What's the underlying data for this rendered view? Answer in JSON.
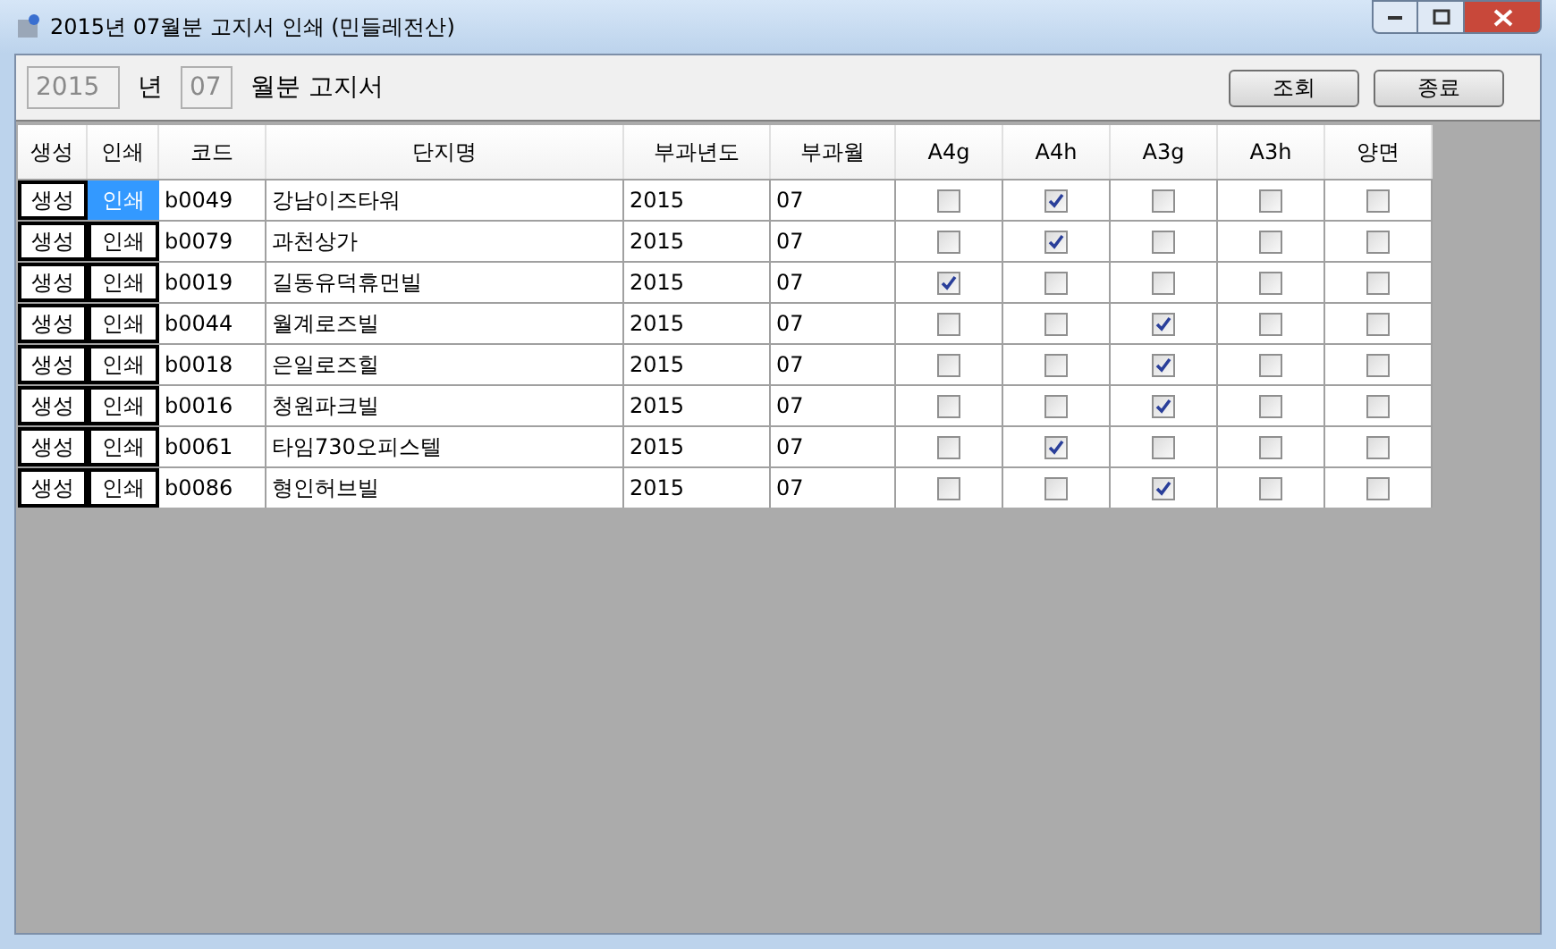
{
  "window": {
    "title": "2015년 07월분 고지서 인쇄 (민들레전산)"
  },
  "toolbar": {
    "year": "2015",
    "year_label": "년",
    "month": "07",
    "month_label": "월분 고지서",
    "buttons": [
      "조회",
      "종료"
    ]
  },
  "table": {
    "columns": [
      "생성",
      "인쇄",
      "코드",
      "단지명",
      "부과년도",
      "부과월",
      "A4g",
      "A4h",
      "A3g",
      "A3h",
      "양면"
    ],
    "rows": [
      {
        "create": "생성",
        "print": "인쇄",
        "selected": true,
        "code": "b0049",
        "name": "강남이즈타워",
        "year": "2015",
        "month": "07",
        "checks": [
          false,
          true,
          false,
          false,
          false
        ]
      },
      {
        "create": "생성",
        "print": "인쇄",
        "selected": false,
        "code": "b0079",
        "name": "과천상가",
        "year": "2015",
        "month": "07",
        "checks": [
          false,
          true,
          false,
          false,
          false
        ]
      },
      {
        "create": "생성",
        "print": "인쇄",
        "selected": false,
        "code": "b0019",
        "name": "길동유덕휴먼빌",
        "year": "2015",
        "month": "07",
        "checks": [
          true,
          false,
          false,
          false,
          false
        ]
      },
      {
        "create": "생성",
        "print": "인쇄",
        "selected": false,
        "code": "b0044",
        "name": "월계로즈빌",
        "year": "2015",
        "month": "07",
        "checks": [
          false,
          false,
          true,
          false,
          false
        ]
      },
      {
        "create": "생성",
        "print": "인쇄",
        "selected": false,
        "code": "b0018",
        "name": "은일로즈힐",
        "year": "2015",
        "month": "07",
        "checks": [
          false,
          false,
          true,
          false,
          false
        ]
      },
      {
        "create": "생성",
        "print": "인쇄",
        "selected": false,
        "code": "b0016",
        "name": "청원파크빌",
        "year": "2015",
        "month": "07",
        "checks": [
          false,
          false,
          true,
          false,
          false
        ]
      },
      {
        "create": "생성",
        "print": "인쇄",
        "selected": false,
        "code": "b0061",
        "name": "타임730오피스텔",
        "year": "2015",
        "month": "07",
        "checks": [
          false,
          true,
          false,
          false,
          false
        ]
      },
      {
        "create": "생성",
        "print": "인쇄",
        "selected": false,
        "code": "b0086",
        "name": "형인허브빌",
        "year": "2015",
        "month": "07",
        "checks": [
          false,
          false,
          true,
          false,
          false
        ]
      }
    ]
  }
}
